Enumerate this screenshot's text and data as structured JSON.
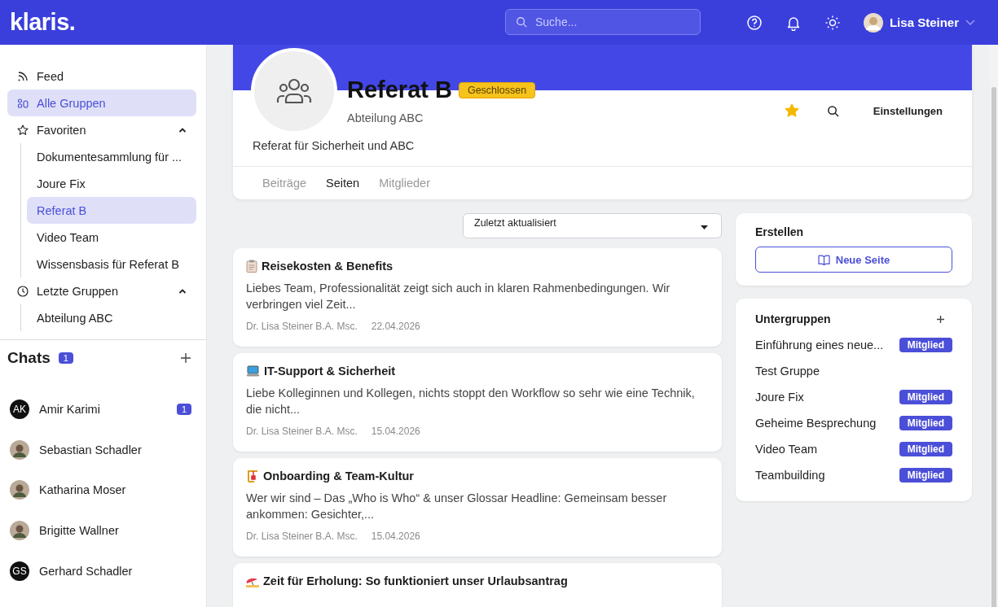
{
  "header": {
    "logo": "klaris.",
    "search": {
      "placeholder": "Suche..."
    },
    "user": {
      "name": "Lisa Steiner"
    }
  },
  "sidebar": {
    "items": [
      {
        "label": "Feed",
        "kind": "feed",
        "selected": false
      },
      {
        "label": "Alle Gruppen",
        "kind": "groups",
        "selected": true
      },
      {
        "label": "Favoriten",
        "kind": "star",
        "selected": false,
        "expanded": true,
        "children": [
          {
            "label": "Dokumentesammlung für ...",
            "selected": false
          },
          {
            "label": "Joure Fix",
            "selected": false
          },
          {
            "label": "Referat B",
            "selected": true
          },
          {
            "label": "Video Team",
            "selected": false
          },
          {
            "label": "Wissensbasis für Referat B",
            "selected": false
          }
        ]
      },
      {
        "label": "Letzte Gruppen",
        "kind": "clock",
        "selected": false,
        "expanded": true,
        "children": [
          {
            "label": "Abteilung ABC",
            "selected": false
          }
        ]
      }
    ]
  },
  "chats": {
    "title": "Chats",
    "count": "1",
    "items": [
      {
        "name": "Amir Karimi",
        "kind": "initials",
        "initials": "AK",
        "unread": "1"
      },
      {
        "name": "Sebastian Schadler",
        "kind": "photo"
      },
      {
        "name": "Katharina Moser",
        "kind": "photo"
      },
      {
        "name": "Brigitte Wallner",
        "kind": "photo"
      },
      {
        "name": "Gerhard Schadler",
        "kind": "initials",
        "initials": "GS"
      }
    ]
  },
  "group": {
    "title": "Referat B",
    "badge": "Geschlossen",
    "department": "Abteilung ABC",
    "description": "Referat für Sicherheit und ABC",
    "favorite": true,
    "settings": "Einstellungen",
    "tabs": [
      {
        "label": "Beiträge",
        "selected": false
      },
      {
        "label": "Seiten",
        "selected": true
      },
      {
        "label": "Mitglieder",
        "selected": false
      }
    ]
  },
  "sort": {
    "value": "Zuletzt aktualisiert"
  },
  "pages": [
    {
      "kind": "clipboard",
      "title": "Reisekosten & Benefits",
      "excerpt": "Liebes Team, Professionalität zeigt sich auch in klaren Rahmenbedingungen. Wir verbringen viel Zeit...",
      "author": "Dr. Lisa Steiner B.A. Msc.",
      "date": "22.04.2026"
    },
    {
      "kind": "laptop",
      "title": "IT-Support & Sicherheit",
      "excerpt": "Liebe Kolleginnen und Kollegen, nichts stoppt den Workflow so sehr wie eine Technik, die nicht...",
      "author": "Dr. Lisa Steiner B.A. Msc.",
      "date": "15.04.2026"
    },
    {
      "kind": "crane",
      "title": "Onboarding & Team-Kultur",
      "excerpt": "Wer wir sind – Das „Who is Who“ & unser Glossar Headline: Gemeinsam besser ankommen: Gesichter,...",
      "author": "Dr. Lisa Steiner B.A. Msc.",
      "date": "15.04.2026"
    },
    {
      "kind": "beach",
      "title": "Zeit für Erholung: So funktioniert unser Urlaubsantrag"
    }
  ],
  "create": {
    "title": "Erstellen",
    "button": "Neue Seite"
  },
  "subgroups": {
    "title": "Untergruppen",
    "items": [
      {
        "name": "Einführung eines neue...",
        "member": true,
        "badge": "Mitglied"
      },
      {
        "name": "Test Gruppe",
        "member": false
      },
      {
        "name": "Joure Fix",
        "member": true,
        "badge": "Mitglied"
      },
      {
        "name": "Geheime Besprechung",
        "member": true,
        "badge": "Mitglied"
      },
      {
        "name": "Video Team",
        "member": true,
        "badge": "Mitglied"
      },
      {
        "name": "Teambuilding",
        "member": true,
        "badge": "Mitglied"
      }
    ]
  }
}
